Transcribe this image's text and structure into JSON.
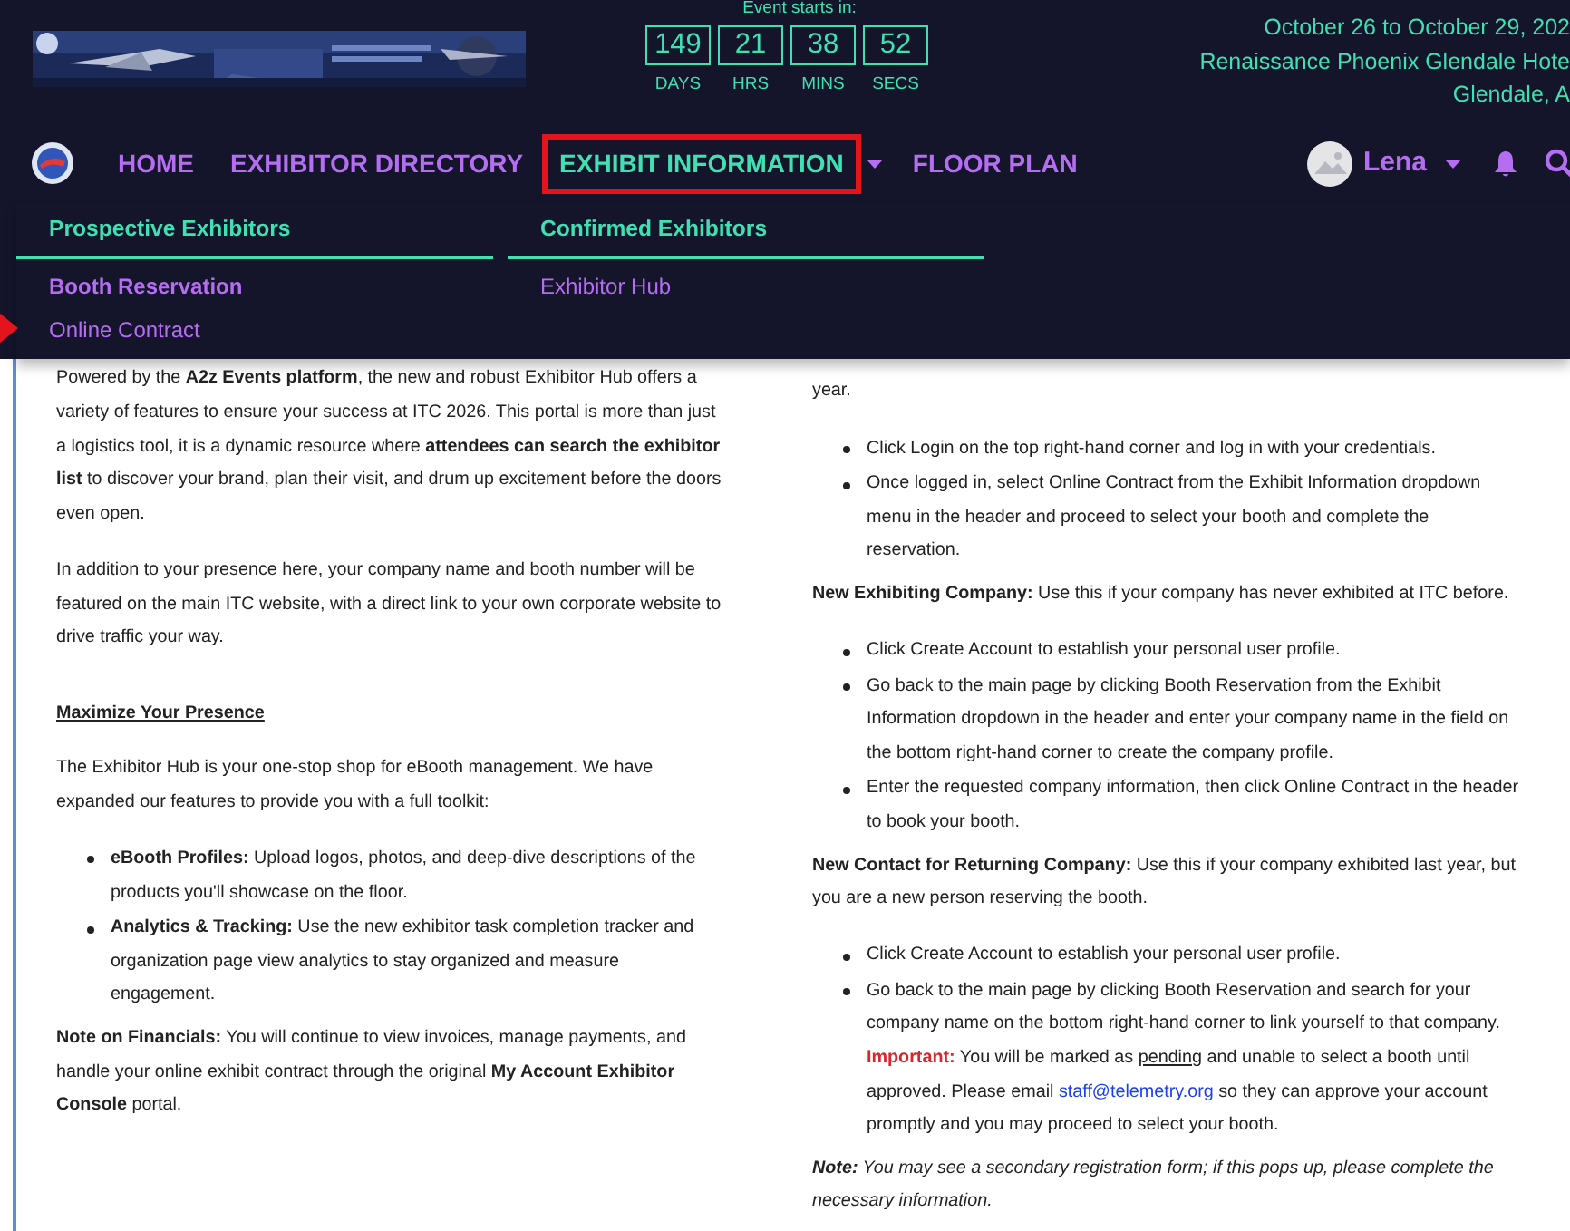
{
  "banner": {
    "kind": "picture"
  },
  "countdown": {
    "caption": "Event starts in:",
    "units": [
      {
        "value": "149",
        "label": "DAYS"
      },
      {
        "value": "21",
        "label": "HRS"
      },
      {
        "value": "38",
        "label": "MINS"
      },
      {
        "value": "52",
        "label": "SECS"
      }
    ]
  },
  "event_info": [
    "October 26 to October 29, 202",
    "Renaissance Phoenix Glendale Hote",
    "Glendale, A"
  ],
  "nav": {
    "items": [
      {
        "label": "HOME",
        "selected": false,
        "dropdown": false,
        "highlighted": false
      },
      {
        "label": "EXHIBITOR DIRECTORY",
        "selected": false,
        "dropdown": false,
        "highlighted": false
      },
      {
        "label": "EXHIBIT INFORMATION",
        "selected": true,
        "dropdown": true,
        "highlighted": true
      },
      {
        "label": "FLOOR PLAN",
        "selected": false,
        "dropdown": false,
        "highlighted": false
      }
    ]
  },
  "user": {
    "name": "Lena"
  },
  "dropdown": {
    "columns": [
      {
        "heading": "Prospective Exhibitors",
        "items": [
          {
            "label": "Booth Reservation",
            "selected": true,
            "pointed": false
          },
          {
            "label": "Online Contract",
            "selected": false,
            "pointed": true
          }
        ]
      },
      {
        "heading": "Confirmed Exhibitors",
        "items": [
          {
            "label": "Exhibitor Hub",
            "selected": false,
            "pointed": false
          }
        ]
      }
    ]
  },
  "left_column": [
    {
      "kind": "paragraph",
      "text": "Powered by the **A2z Events platform**, the new and robust Exhibitor Hub offers a variety of features to ensure your success at ITC 2026. This portal is more than just a logistics tool, it is a dynamic resource where **attendees can search the exhibitor list** to discover your brand, plan their visit, and drum up excitement before the doors even open."
    },
    {
      "kind": "paragraph",
      "text": "In addition to your presence here, your company name and booth number will be featured on the main ITC website, with a direct link to your own corporate website to drive traffic your way."
    },
    {
      "kind": "heading",
      "text": "Maximize Your Presence"
    },
    {
      "kind": "paragraph",
      "text": "The Exhibitor Hub is your one-stop shop for eBooth management. We have expanded our features to provide you with a full toolkit:"
    },
    {
      "kind": "list",
      "items": [
        {
          "segments": [
            {
              "kind": "text",
              "text": "**eBooth Profiles:** Upload logos, photos, and deep-dive descriptions of the products you'll showcase on the floor."
            }
          ]
        },
        {
          "segments": [
            {
              "kind": "text",
              "text": "**Analytics & Tracking:** Use the new exhibitor task completion tracker and organization page view analytics to stay organized and measure engagement."
            }
          ]
        }
      ]
    },
    {
      "kind": "paragraph",
      "text": "**Note on Financials:** You will continue to view invoices, manage payments, and handle your online exhibit contract through the original **My Account Exhibitor Console** portal."
    }
  ],
  "right_column": [
    {
      "kind": "paragraph",
      "text": "year."
    },
    {
      "kind": "list",
      "items": [
        {
          "segments": [
            {
              "kind": "text",
              "text": "Click Login on the top right-hand corner and log in with your credentials."
            }
          ]
        },
        {
          "segments": [
            {
              "kind": "text",
              "text": "Once logged in, select Online Contract from the Exhibit Information dropdown menu in the header and proceed to select your booth and complete the reservation."
            }
          ]
        }
      ]
    },
    {
      "kind": "paragraph",
      "text": "**New Exhibiting Company:** Use this if your company has never exhibited at ITC before."
    },
    {
      "kind": "list",
      "items": [
        {
          "segments": [
            {
              "kind": "text",
              "text": "Click Create Account to establish your personal user profile."
            }
          ]
        },
        {
          "segments": [
            {
              "kind": "text",
              "text": "Go back to the main page by clicking Booth Reservation from the Exhibit Information dropdown in the header and enter your company name in the field on the bottom right-hand corner to create the company profile."
            }
          ]
        },
        {
          "segments": [
            {
              "kind": "text",
              "text": "Enter the requested company information, then click Online Contract in the header to book your booth."
            }
          ]
        }
      ]
    },
    {
      "kind": "paragraph",
      "text": "**New Contact for Returning Company:** Use this if your company exhibited last year, but you are a new person reserving the booth."
    },
    {
      "kind": "list",
      "items": [
        {
          "segments": [
            {
              "kind": "text",
              "text": "Click Create Account to establish your personal user profile."
            }
          ]
        },
        {
          "segments": [
            {
              "kind": "text",
              "text": "Go back to the main page by clicking Booth Reservation and search for your company name on the bottom right-hand corner to link yourself to that company. "
            },
            {
              "kind": "important",
              "text": "Important:"
            },
            {
              "kind": "text",
              "text": " You will be marked as "
            },
            {
              "kind": "underline",
              "text": "pending"
            },
            {
              "kind": "text",
              "text": " and unable to select a booth until approved. Please email "
            },
            {
              "kind": "link",
              "text": "staff@telemetry.org"
            },
            {
              "kind": "text",
              "text": " so they can approve your account promptly and you may proceed to select your booth."
            }
          ]
        }
      ]
    },
    {
      "kind": "note",
      "text": "**Note:** You may see a secondary registration form; if this pops up, please complete the necessary information."
    }
  ]
}
